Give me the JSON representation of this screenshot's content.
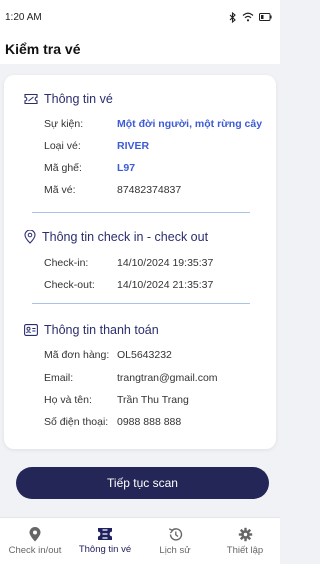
{
  "status_bar": {
    "time": "1:20 AM"
  },
  "header": {
    "title": "Kiểm tra vé"
  },
  "ticket_info": {
    "title": "Thông tin vé",
    "rows": [
      {
        "key": "Sự kiện:",
        "value": "Một đời người, một rừng cây",
        "highlight": true
      },
      {
        "key": "Loại vé:",
        "value": "RIVER",
        "highlight": true
      },
      {
        "key": "Mã ghế:",
        "value": "L97",
        "highlight": true
      },
      {
        "key": "Mã vé:",
        "value": "87482374837",
        "highlight": false
      }
    ]
  },
  "checkin_info": {
    "title": "Thông tin check in - check out",
    "rows": [
      {
        "key": "Check-in:",
        "value": "14/10/2024 19:35:37"
      },
      {
        "key": "Check-out:",
        "value": "14/10/2024 21:35:37"
      }
    ]
  },
  "payment_info": {
    "title": "Thông tin thanh toán",
    "rows": [
      {
        "key": "Mã đơn hàng:",
        "value": "OL5643232"
      },
      {
        "key": "Email:",
        "value": "trangtran@gmail.com"
      },
      {
        "key": "Họ và tên:",
        "value": "Trần Thu Trang"
      },
      {
        "key": "Số điện thoại:",
        "value": "0988 888 888"
      }
    ]
  },
  "actions": {
    "continue_scan": "Tiếp tục scan"
  },
  "bottom_nav": {
    "items": [
      {
        "label": "Check in/out",
        "icon": "location-pin-icon"
      },
      {
        "label": "Thông tin vé",
        "icon": "ticket-icon",
        "active": true
      },
      {
        "label": "Lịch sử",
        "icon": "history-icon"
      },
      {
        "label": "Thiết lập",
        "icon": "gear-icon"
      }
    ]
  },
  "colors": {
    "accent": "#242657",
    "link_blue": "#3d5bd6",
    "background": "#f1f2f6"
  }
}
